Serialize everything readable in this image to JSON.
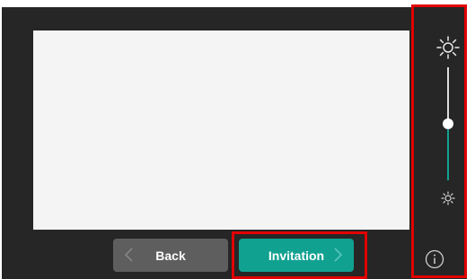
{
  "buttons": {
    "back_label": "Back",
    "invitation_label": "Invitation"
  },
  "brightness": {
    "level_fraction": 0.5
  },
  "colors": {
    "accent": "#11a191",
    "highlight": "#e00000",
    "background": "#262626"
  },
  "icons": {
    "brightness_high": "sun-icon",
    "brightness_low": "sun-small-icon",
    "info": "info-icon",
    "back_arrow": "chevron-left-icon",
    "forward_arrow": "chevron-right-icon"
  }
}
